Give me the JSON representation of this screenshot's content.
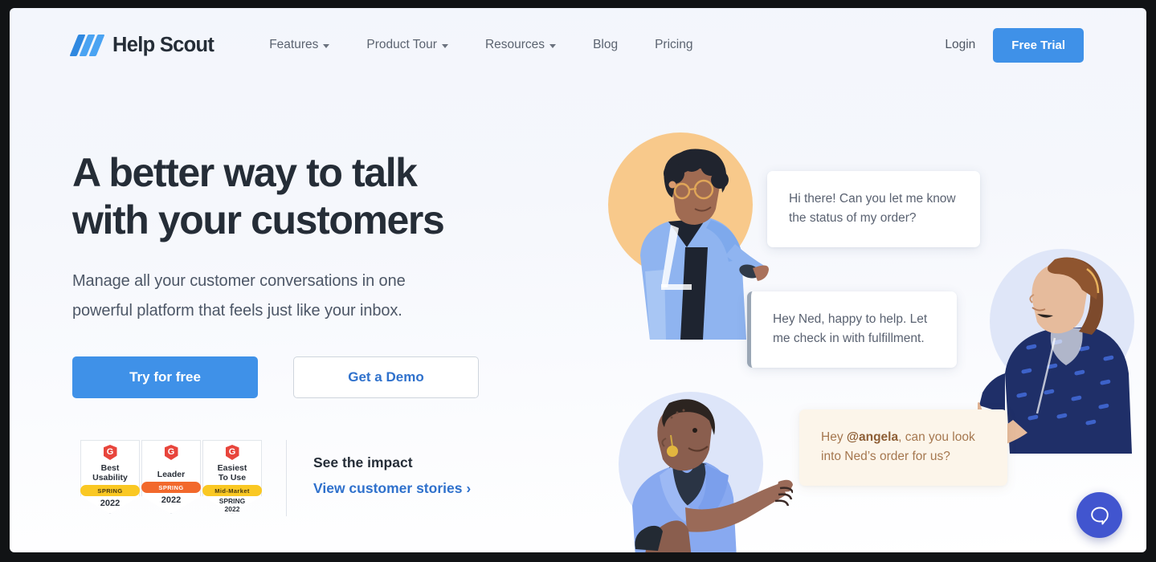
{
  "brand": {
    "logo_text": "Help Scout",
    "accent_blue": "#3f91e8",
    "link_blue": "#2f71cc",
    "heading_navy": "#252d37",
    "beacon_blue": "#4155cf"
  },
  "nav": {
    "links": [
      {
        "label": "Features",
        "has_caret": true
      },
      {
        "label": "Product Tour",
        "has_caret": true
      },
      {
        "label": "Resources",
        "has_caret": true
      },
      {
        "label": "Blog",
        "has_caret": false
      },
      {
        "label": "Pricing",
        "has_caret": false
      }
    ],
    "login_label": "Login",
    "free_trial_label": "Free Trial"
  },
  "hero": {
    "headline": "A better way to talk\nwith your customers",
    "subhead": "Manage all your customer conversations in one\npowerful platform that feels just like your inbox.",
    "primary_cta": "Try for free",
    "secondary_cta": "Get a Demo"
  },
  "badges": [
    {
      "vendor": "G",
      "title": "Best\nUsability",
      "ribbon": "SPRING",
      "ribbon_color": "yellow",
      "year": "2022"
    },
    {
      "vendor": "G",
      "title": "Leader",
      "ribbon": "SPRING",
      "ribbon_color": "orange",
      "year": "2022"
    },
    {
      "vendor": "G",
      "title": "Easiest\nTo Use",
      "ribbon": "Mid-Market",
      "ribbon_color": "yellow",
      "year": "SPRING\n2022"
    }
  ],
  "impact": {
    "title": "See the impact",
    "link": "View customer stories ›"
  },
  "chat": {
    "bubble1": "Hi there! Can you let me know\nthe status of my order?",
    "bubble2": "Hey Ned, happy to help. Let\nme check in with fulfillment.",
    "bubble3_prefix": "Hey ",
    "bubble3_mention": "@angela",
    "bubble3_suffix": ", can you look\ninto Ned’s order for us?"
  },
  "beacon": {
    "icon": "chat-bubble-icon"
  }
}
